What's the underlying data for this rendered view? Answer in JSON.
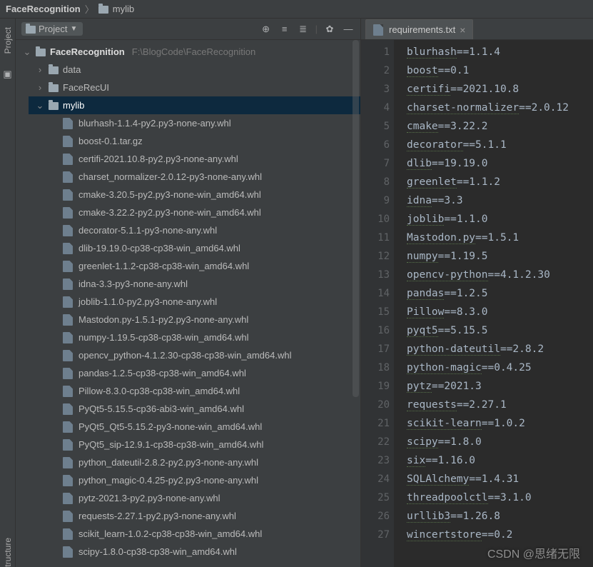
{
  "breadcrumb": {
    "root": "FaceRecognition",
    "sub": "mylib"
  },
  "panel": {
    "title": "Project"
  },
  "project": {
    "name": "FaceRecognition",
    "path": "F:\\BlogCode\\FaceRecognition",
    "folders": [
      "data",
      "FaceRecUI",
      "mylib"
    ],
    "mylib_files": [
      "blurhash-1.1.4-py2.py3-none-any.whl",
      "boost-0.1.tar.gz",
      "certifi-2021.10.8-py2.py3-none-any.whl",
      "charset_normalizer-2.0.12-py3-none-any.whl",
      "cmake-3.20.5-py2.py3-none-win_amd64.whl",
      "cmake-3.22.2-py2.py3-none-win_amd64.whl",
      "decorator-5.1.1-py3-none-any.whl",
      "dlib-19.19.0-cp38-cp38-win_amd64.whl",
      "greenlet-1.1.2-cp38-cp38-win_amd64.whl",
      "idna-3.3-py3-none-any.whl",
      "joblib-1.1.0-py2.py3-none-any.whl",
      "Mastodon.py-1.5.1-py2.py3-none-any.whl",
      "numpy-1.19.5-cp38-cp38-win_amd64.whl",
      "opencv_python-4.1.2.30-cp38-cp38-win_amd64.whl",
      "pandas-1.2.5-cp38-cp38-win_amd64.whl",
      "Pillow-8.3.0-cp38-cp38-win_amd64.whl",
      "PyQt5-5.15.5-cp36-abi3-win_amd64.whl",
      "PyQt5_Qt5-5.15.2-py3-none-win_amd64.whl",
      "PyQt5_sip-12.9.1-cp38-cp38-win_amd64.whl",
      "python_dateutil-2.8.2-py2.py3-none-any.whl",
      "python_magic-0.4.25-py2.py3-none-any.whl",
      "pytz-2021.3-py2.py3-none-any.whl",
      "requests-2.27.1-py2.py3-none-any.whl",
      "scikit_learn-1.0.2-cp38-cp38-win_amd64.whl",
      "scipy-1.8.0-cp38-cp38-win_amd64.whl"
    ]
  },
  "editor": {
    "tab_name": "requirements.txt",
    "lines": [
      "blurhash==1.1.4",
      "boost==0.1",
      "certifi==2021.10.8",
      "charset-normalizer==2.0.12",
      "cmake==3.22.2",
      "decorator==5.1.1",
      "dlib==19.19.0",
      "greenlet==1.1.2",
      "idna==3.3",
      "joblib==1.1.0",
      "Mastodon.py==1.5.1",
      "numpy==1.19.5",
      "opencv-python==4.1.2.30",
      "pandas==1.2.5",
      "Pillow==8.3.0",
      "pyqt5==5.15.5",
      "python-dateutil==2.8.2",
      "python-magic==0.4.25",
      "pytz==2021.3",
      "requests==2.27.1",
      "scikit-learn==1.0.2",
      "scipy==1.8.0",
      "six==1.16.0",
      "SQLAlchemy==1.4.31",
      "threadpoolctl==3.1.0",
      "urllib3==1.26.8",
      "wincertstore==0.2"
    ]
  },
  "gutter_labels": {
    "project": "Project",
    "structure": "tructure"
  },
  "watermark": "CSDN @思绪无限"
}
